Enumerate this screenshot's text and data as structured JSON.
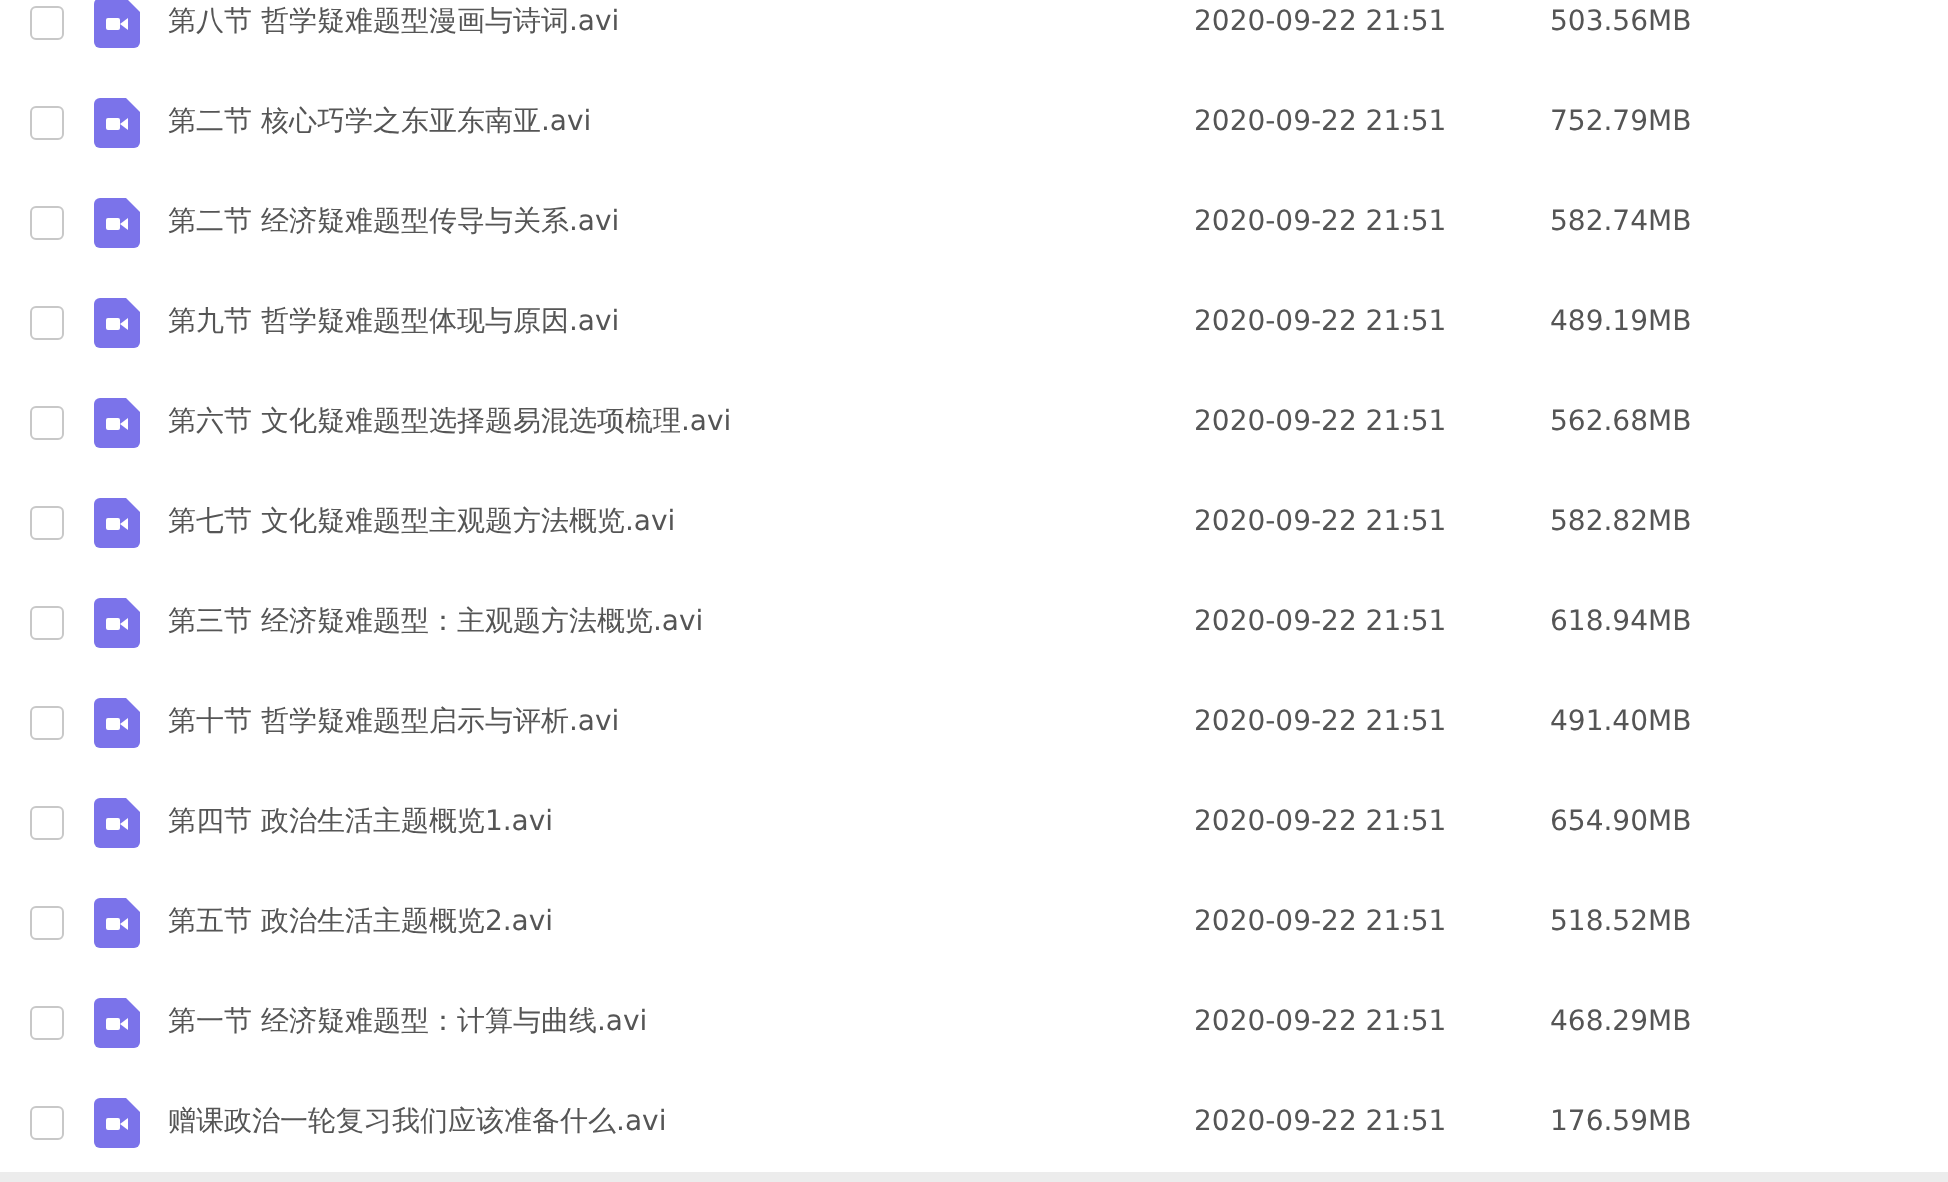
{
  "files": [
    {
      "name": "第八节 哲学疑难题型漫画与诗词.avi",
      "date": "2020-09-22 21:51",
      "size": "503.56MB",
      "checked": false
    },
    {
      "name": "第二节 核心巧学之东亚东南亚.avi",
      "date": "2020-09-22 21:51",
      "size": "752.79MB",
      "checked": false
    },
    {
      "name": "第二节 经济疑难题型传导与关系.avi",
      "date": "2020-09-22 21:51",
      "size": "582.74MB",
      "checked": false
    },
    {
      "name": "第九节 哲学疑难题型体现与原因.avi",
      "date": "2020-09-22 21:51",
      "size": "489.19MB",
      "checked": false
    },
    {
      "name": "第六节 文化疑难题型选择题易混选项梳理.avi",
      "date": "2020-09-22 21:51",
      "size": "562.68MB",
      "checked": false
    },
    {
      "name": "第七节 文化疑难题型主观题方法概览.avi",
      "date": "2020-09-22 21:51",
      "size": "582.82MB",
      "checked": false
    },
    {
      "name": "第三节 经济疑难题型：主观题方法概览.avi",
      "date": "2020-09-22 21:51",
      "size": "618.94MB",
      "checked": false
    },
    {
      "name": "第十节 哲学疑难题型启示与评析.avi",
      "date": "2020-09-22 21:51",
      "size": "491.40MB",
      "checked": false
    },
    {
      "name": "第四节 政治生活主题概览1.avi",
      "date": "2020-09-22 21:51",
      "size": "654.90MB",
      "checked": false
    },
    {
      "name": "第五节 政治生活主题概览2.avi",
      "date": "2020-09-22 21:51",
      "size": "518.52MB",
      "checked": false
    },
    {
      "name": "第一节 经济疑难题型：计算与曲线.avi",
      "date": "2020-09-22 21:51",
      "size": "468.29MB",
      "checked": false
    },
    {
      "name": "赠课政治一轮复习我们应该准备什么.avi",
      "date": "2020-09-22 21:51",
      "size": "176.59MB",
      "checked": false
    }
  ]
}
